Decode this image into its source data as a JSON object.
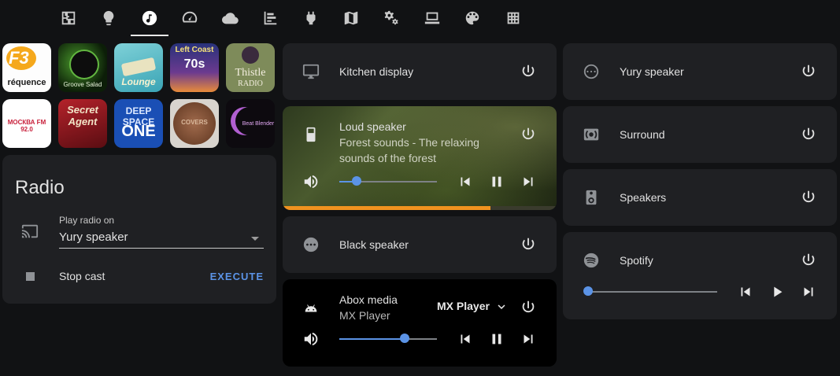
{
  "colors": {
    "accent": "#5b93e6",
    "progress": "#f0921f",
    "card": "#1f2023",
    "background": "#111214"
  },
  "nav": {
    "tabs": [
      {
        "icon": "floorplan-icon"
      },
      {
        "icon": "lightbulb-icon"
      },
      {
        "icon": "music-note-icon",
        "active": true
      },
      {
        "icon": "speedometer-icon"
      },
      {
        "icon": "cloud-icon"
      },
      {
        "icon": "chart-timeline-icon"
      },
      {
        "icon": "power-plug-icon"
      },
      {
        "icon": "map-icon"
      },
      {
        "icon": "cogs-icon"
      },
      {
        "icon": "laptop-icon"
      },
      {
        "icon": "palette-icon"
      },
      {
        "icon": "grid-icon"
      }
    ]
  },
  "stations": [
    {
      "label": "réquence",
      "logo": "F3"
    },
    {
      "label": "Groove Salad"
    },
    {
      "label": "Lounge"
    },
    {
      "label": "Left Coast",
      "badge": "70s"
    },
    {
      "label": "Thistle",
      "sub": "RADIO"
    },
    {
      "label": "МОСКВА FM 92.0"
    },
    {
      "label": "Secret Agent"
    },
    {
      "label": "DEEP SPACE",
      "sub": "ONE"
    },
    {
      "label": "COVERS"
    },
    {
      "label": "Beat Blender"
    }
  ],
  "radio": {
    "title": "Radio",
    "play_label": "Play radio on",
    "play_value": "Yury speaker",
    "stop_label": "Stop cast",
    "execute_label": "EXECUTE"
  },
  "players": {
    "kitchen": {
      "name": "Kitchen display"
    },
    "loud": {
      "name": "Loud speaker",
      "track_line1": "Forest sounds - The relaxing",
      "track_line2": "sounds of the forest",
      "volume": 0.18,
      "progress": 0.76
    },
    "black": {
      "name": "Black speaker"
    },
    "abox": {
      "name": "Abox media",
      "app": "MX Player",
      "source": "MX Player",
      "volume": 0.67
    },
    "yury": {
      "name": "Yury speaker"
    },
    "surround": {
      "name": "Surround"
    },
    "speakers": {
      "name": "Speakers"
    },
    "spotify": {
      "name": "Spotify",
      "volume": 0.0
    }
  }
}
